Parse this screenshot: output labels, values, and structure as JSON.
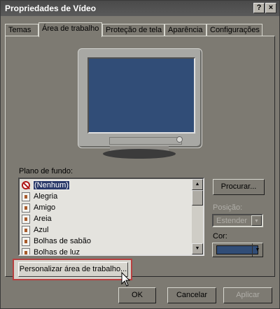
{
  "window": {
    "title": "Propriedades de Vídeo",
    "help_label": "?",
    "close_label": "×"
  },
  "tabs": [
    {
      "label": "Temas"
    },
    {
      "label": "Área de trabalho"
    },
    {
      "label": "Proteção de tela"
    },
    {
      "label": "Aparência"
    },
    {
      "label": "Configurações"
    }
  ],
  "background": {
    "label": "Plano de fundo:",
    "items": [
      {
        "label": "(Nenhum)",
        "icon": "none-icon"
      },
      {
        "label": "Alegria",
        "icon": "image-file-icon"
      },
      {
        "label": "Amigo",
        "icon": "image-file-icon"
      },
      {
        "label": "Areia",
        "icon": "image-file-icon"
      },
      {
        "label": "Azul",
        "icon": "image-file-icon"
      },
      {
        "label": "Bolhas de sabão",
        "icon": "image-file-icon"
      },
      {
        "label": "Bolhas de luz",
        "icon": "image-file-icon"
      }
    ],
    "selected": "(Nenhum)"
  },
  "browse_label": "Procurar...",
  "position": {
    "label": "Posição:",
    "value": "Estender"
  },
  "color": {
    "label": "Cor:",
    "value": "#314d77"
  },
  "customize_label": "Personalizar área de trabalho...",
  "footer": {
    "ok": "OK",
    "cancel": "Cancelar",
    "apply": "Aplicar"
  }
}
